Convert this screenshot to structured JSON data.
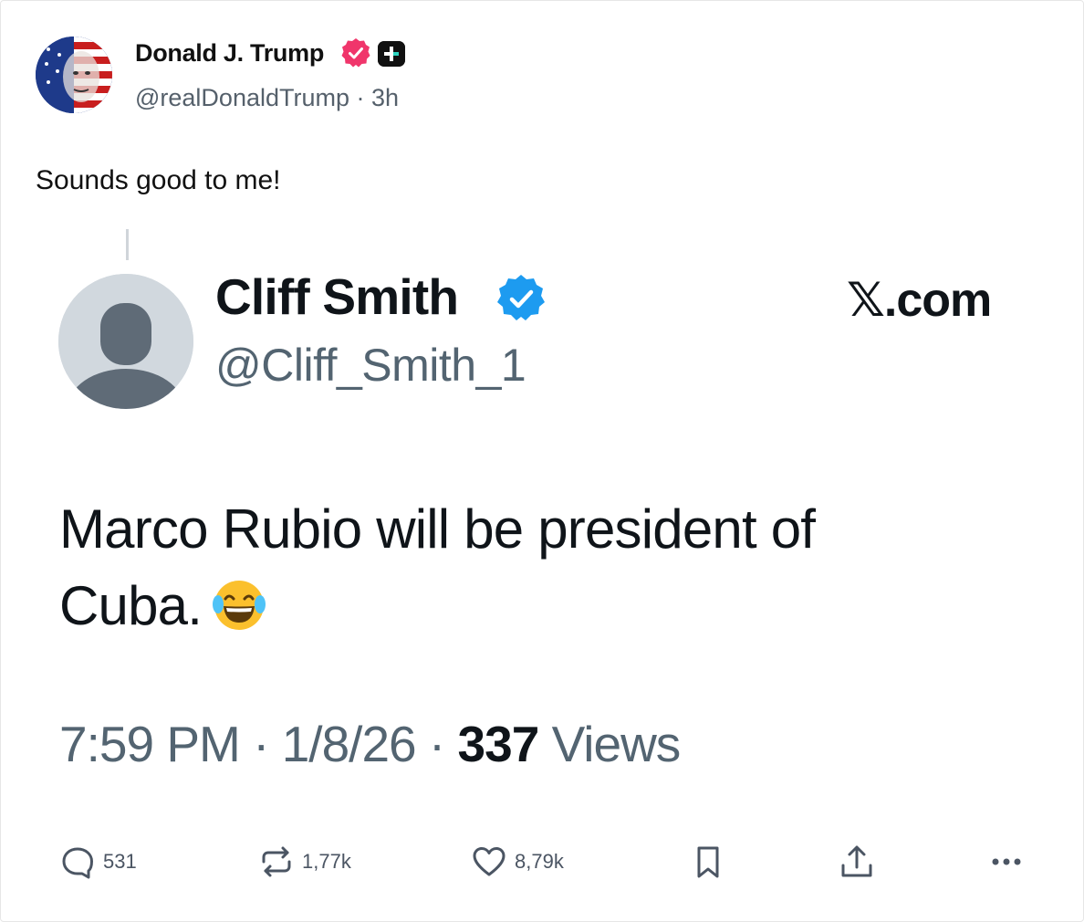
{
  "author": {
    "name": "Donald J. Trump",
    "handle": "@realDonaldTrump",
    "separator": "·",
    "time": "3h"
  },
  "post": {
    "text": "Sounds good to me!"
  },
  "embedded": {
    "name": "Cliff Smith",
    "handle": "@Cliff_Smith_1",
    "site": "𝕏.com",
    "body_line1": "Marco Rubio will be president of",
    "body_line2": "Cuba.",
    "time": "7:59 PM",
    "sep1": "·",
    "date": "1/8/26",
    "sep2": "·",
    "views_count": "337",
    "views_label": "Views"
  },
  "actions": {
    "reply_count": "531",
    "repost_count": "1,77k",
    "like_count": "8,79k"
  },
  "icons": {
    "verified": "verified-badge-icon",
    "plus": "plus-badge-icon",
    "reply": "reply-icon",
    "repost": "repost-icon",
    "like": "heart-icon",
    "bookmark": "bookmark-icon",
    "share": "share-icon",
    "more": "more-icon"
  },
  "colors": {
    "verified_pink": "#f0356b",
    "x_verified_blue": "#1d9bf0",
    "text_secondary": "#536471"
  }
}
